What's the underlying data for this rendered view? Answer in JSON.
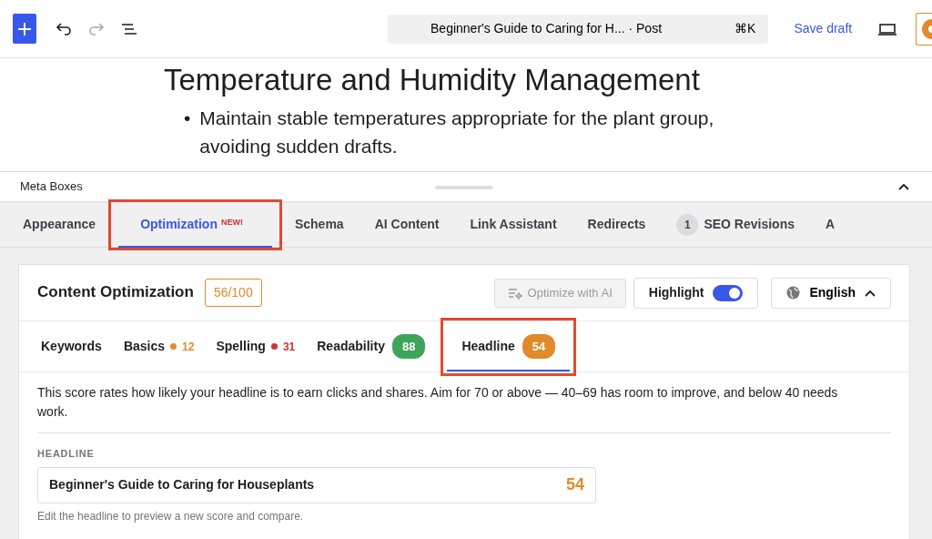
{
  "toolbar": {
    "title": "Beginner's Guide to Caring for H... · Post",
    "shortcut": "⌘K",
    "save_label": "Save draft",
    "redo_disabled": true
  },
  "content": {
    "heading": "Temperature and Humidity Management",
    "bullets": [
      {
        "marker": "•",
        "text": "Maintain stable temperatures appropriate for the plant group, avoiding sudden drafts."
      }
    ]
  },
  "meta_boxes": {
    "title": "Meta Boxes",
    "expanded": true
  },
  "tabs": [
    {
      "label": "Appearance",
      "selected": false,
      "annotated": false
    },
    {
      "label": "Optimization",
      "badge": "NEW!",
      "selected": true,
      "annotated": true
    },
    {
      "label": "Schema",
      "selected": false,
      "annotated": false
    },
    {
      "label": "AI Content",
      "selected": false,
      "annotated": false
    },
    {
      "label": "Link Assistant",
      "selected": false,
      "annotated": false
    },
    {
      "label": "Redirects",
      "selected": false,
      "annotated": false
    },
    {
      "label": "SEO Revisions",
      "count": "1",
      "selected": false,
      "annotated": false
    },
    {
      "label": "A",
      "selected": false,
      "annotated": false
    }
  ],
  "panel": {
    "title": "Content Optimization",
    "score": "56/100",
    "ai_button": {
      "label": "Optimize with AI",
      "disabled": true
    },
    "highlight": {
      "label": "Highlight",
      "on": true
    },
    "language": {
      "label": "English",
      "expanded": true
    }
  },
  "subtabs": [
    {
      "label": "Keywords",
      "selected": false,
      "annotated": false
    },
    {
      "label": "Basics",
      "kind": "dot",
      "value": "12",
      "color": "#e08a2c",
      "selected": false,
      "annotated": false
    },
    {
      "label": "Spelling",
      "kind": "dot",
      "value": "31",
      "color": "#cc3333",
      "selected": false,
      "annotated": false
    },
    {
      "label": "Readability",
      "kind": "pill",
      "value": "88",
      "color": "#3fa45a",
      "selected": false,
      "annotated": false
    },
    {
      "label": "Headline",
      "kind": "pill",
      "value": "54",
      "color": "#e08a2c",
      "selected": true,
      "annotated": true
    }
  ],
  "headline": {
    "description": "This score rates how likely your headline is to earn clicks and shares. Aim for 70 or above — 40–69 has room to improve, and below 40 needs work.",
    "field_label": "HEADLINE",
    "value": "Beginner's Guide to Caring for Houseplants",
    "score": "54",
    "hint": "Edit the headline to preview a new score and compare."
  }
}
